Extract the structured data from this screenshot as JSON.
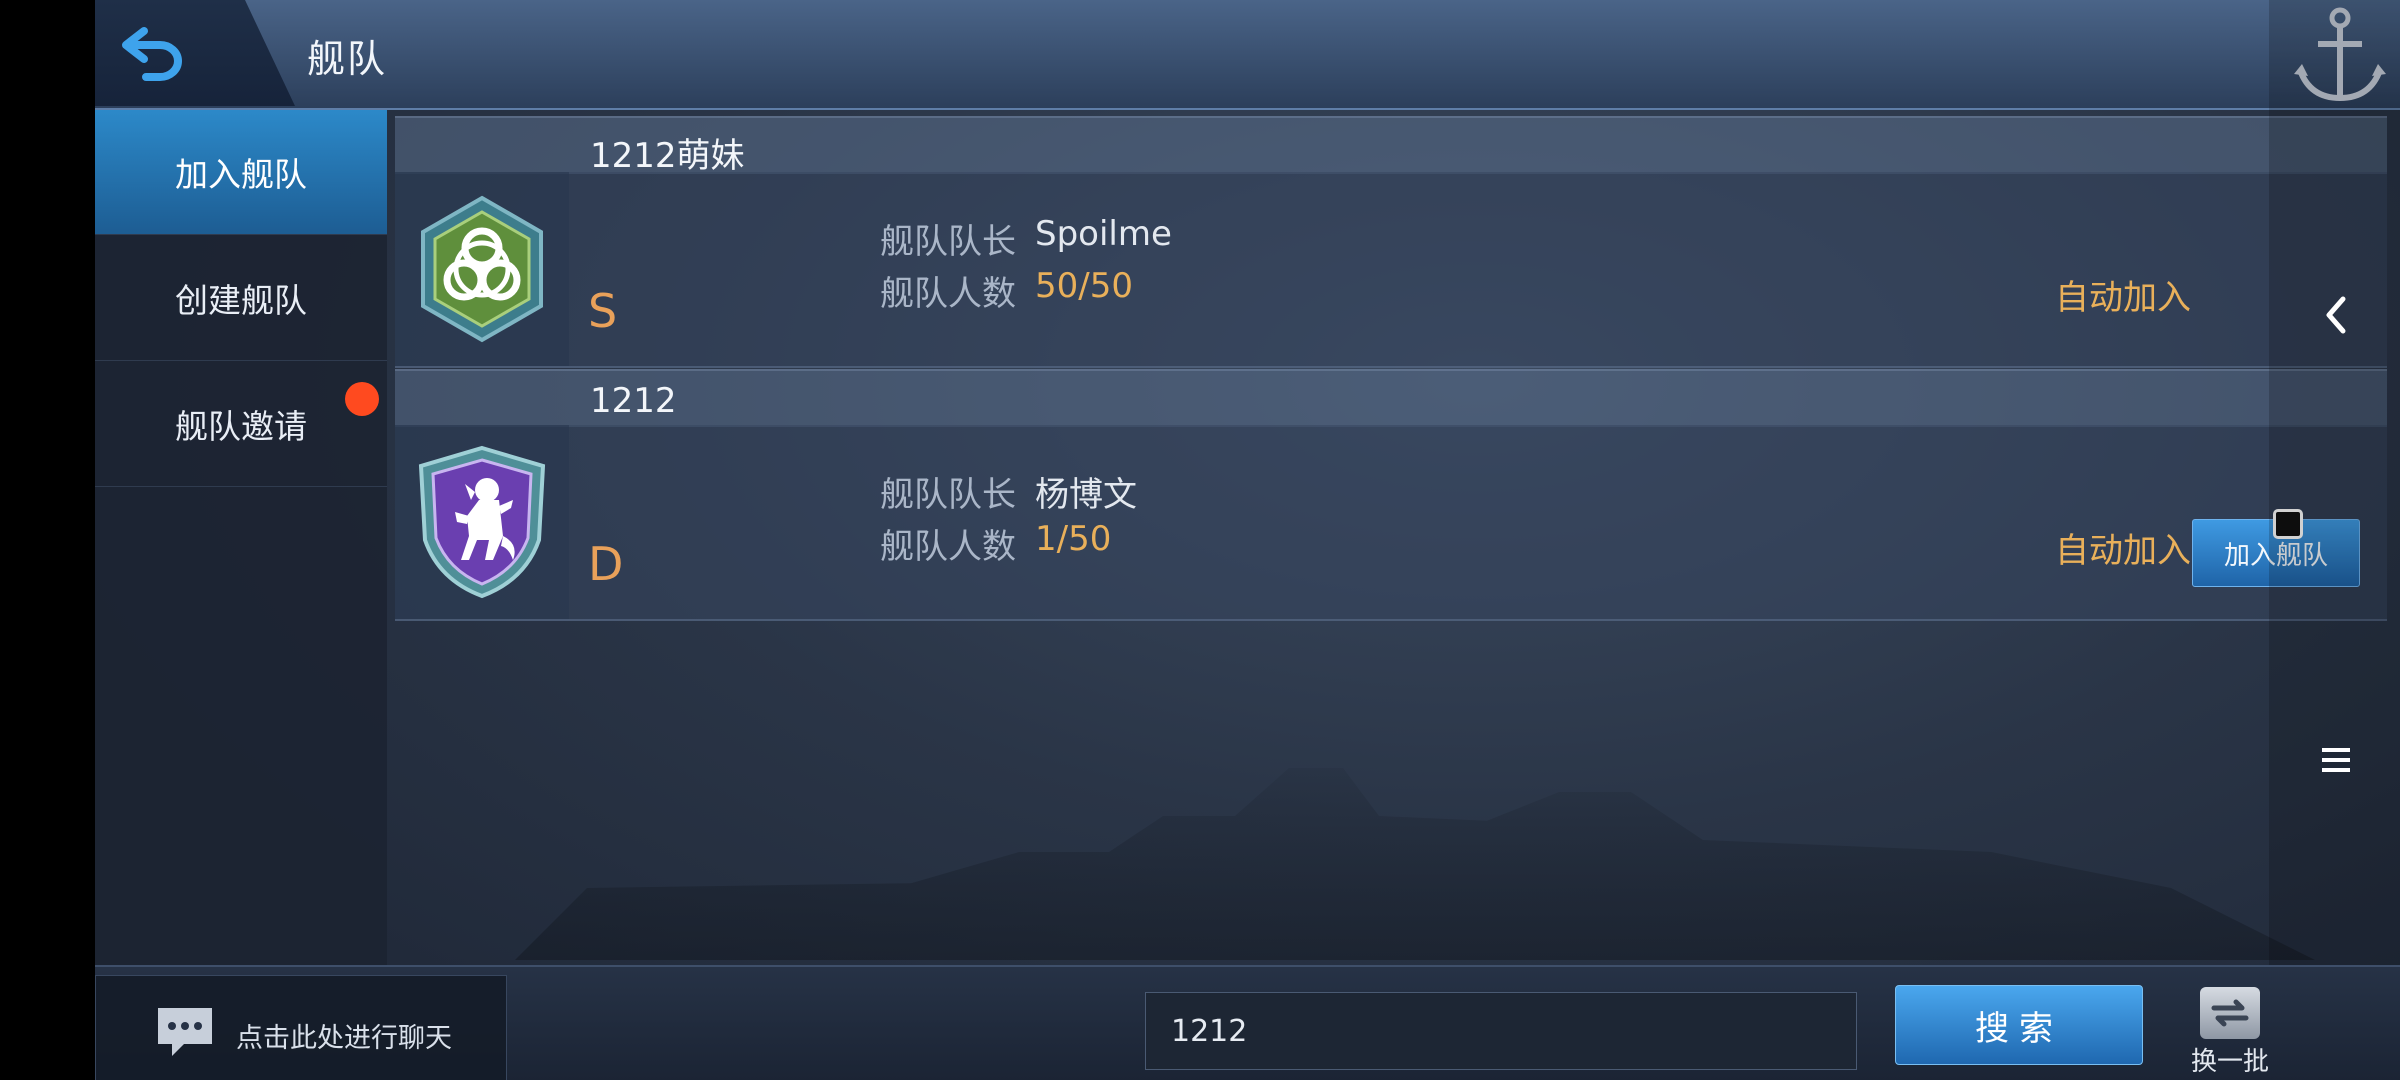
{
  "header": {
    "title": "舰队"
  },
  "sidebar": {
    "items": [
      {
        "label": "加入舰队",
        "active": true
      },
      {
        "label": "创建舰队",
        "active": false
      },
      {
        "label": "舰队邀请",
        "active": false,
        "has_notification": true
      }
    ]
  },
  "fleets": [
    {
      "name": "1212萌妹",
      "grade": "S",
      "captain_label": "舰队队长",
      "captain": "Spoilme",
      "members_label": "舰队人数",
      "members": "50/50",
      "join_mode": "自动加入",
      "emblem": "biohazard-emblem-icon"
    },
    {
      "name": "1212",
      "grade": "D",
      "captain_label": "舰队队长",
      "captain": "杨博文",
      "members_label": "舰队人数",
      "members": "1/50",
      "join_mode": "自动加入",
      "emblem": "lion-shield-emblem-icon",
      "join_button": "加入舰队"
    }
  ],
  "footer": {
    "chat_text": "点击此处进行聊天",
    "search_value": "1212",
    "search_button": "搜索",
    "refresh_label": "换一批"
  },
  "colors": {
    "accent": "#2c89c9",
    "grade": "#e9a15a",
    "value_gold": "#e9b05a",
    "notification": "#ff4a1f"
  }
}
